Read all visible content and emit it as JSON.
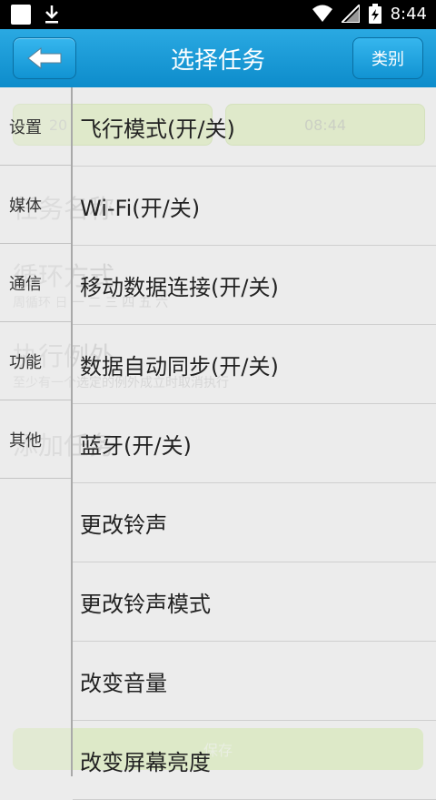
{
  "status_bar": {
    "time": "8:44"
  },
  "header": {
    "title": "选择任务",
    "category_button": "类别"
  },
  "background_form": {
    "date_text": "20",
    "time_text": "08:44",
    "task_name_label": "任务名称",
    "loop_label": "循环方式",
    "loop_detail": "周循环 日 一 二 三 四 五 六",
    "exception_label": "执行例外",
    "exception_detail": "至少有一个选定的例外成立时取消执行",
    "add_task_label": "添加任务",
    "save_label": "保存"
  },
  "sidebar": {
    "items": [
      {
        "label": "设置"
      },
      {
        "label": "媒体"
      },
      {
        "label": "通信"
      },
      {
        "label": "功能"
      },
      {
        "label": "其他"
      }
    ]
  },
  "tasks": [
    {
      "label": "飞行模式(开/关)"
    },
    {
      "label": "Wi-Fi(开/关)"
    },
    {
      "label": "移动数据连接(开/关)"
    },
    {
      "label": "数据自动同步(开/关)"
    },
    {
      "label": "蓝牙(开/关)"
    },
    {
      "label": "更改铃声"
    },
    {
      "label": "更改铃声模式"
    },
    {
      "label": "改变音量"
    },
    {
      "label": "改变屏幕亮度"
    }
  ]
}
